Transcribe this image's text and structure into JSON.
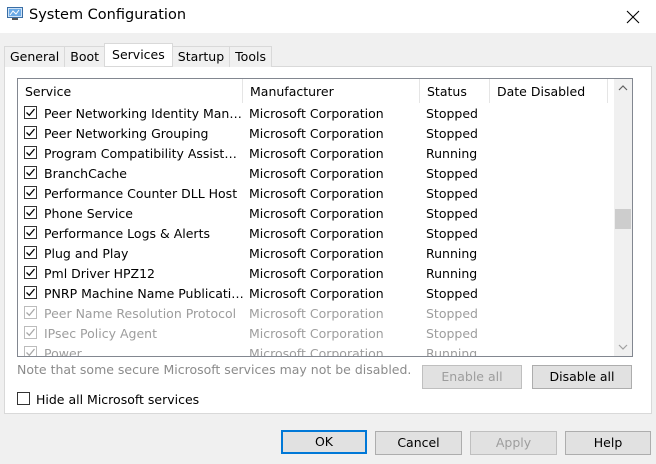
{
  "window": {
    "title": "System Configuration"
  },
  "tabs": [
    {
      "label": "General"
    },
    {
      "label": "Boot"
    },
    {
      "label": "Services",
      "active": true
    },
    {
      "label": "Startup"
    },
    {
      "label": "Tools"
    }
  ],
  "table": {
    "columns": [
      "Service",
      "Manufacturer",
      "Status",
      "Date Disabled"
    ],
    "rows": [
      {
        "service": "Peer Networking Identity Manager",
        "manufacturer": "Microsoft Corporation",
        "status": "Stopped",
        "date_disabled": "",
        "checked": true,
        "disabled": false
      },
      {
        "service": "Peer Networking Grouping",
        "manufacturer": "Microsoft Corporation",
        "status": "Stopped",
        "date_disabled": "",
        "checked": true,
        "disabled": false
      },
      {
        "service": "Program Compatibility Assistant ...",
        "manufacturer": "Microsoft Corporation",
        "status": "Running",
        "date_disabled": "",
        "checked": true,
        "disabled": false
      },
      {
        "service": "BranchCache",
        "manufacturer": "Microsoft Corporation",
        "status": "Stopped",
        "date_disabled": "",
        "checked": true,
        "disabled": false
      },
      {
        "service": "Performance Counter DLL Host",
        "manufacturer": "Microsoft Corporation",
        "status": "Stopped",
        "date_disabled": "",
        "checked": true,
        "disabled": false
      },
      {
        "service": "Phone Service",
        "manufacturer": "Microsoft Corporation",
        "status": "Stopped",
        "date_disabled": "",
        "checked": true,
        "disabled": false
      },
      {
        "service": "Performance Logs & Alerts",
        "manufacturer": "Microsoft Corporation",
        "status": "Stopped",
        "date_disabled": "",
        "checked": true,
        "disabled": false
      },
      {
        "service": "Plug and Play",
        "manufacturer": "Microsoft Corporation",
        "status": "Running",
        "date_disabled": "",
        "checked": true,
        "disabled": false
      },
      {
        "service": "Pml Driver HPZ12",
        "manufacturer": "Microsoft Corporation",
        "status": "Running",
        "date_disabled": "",
        "checked": true,
        "disabled": false
      },
      {
        "service": "PNRP Machine Name Publication...",
        "manufacturer": "Microsoft Corporation",
        "status": "Stopped",
        "date_disabled": "",
        "checked": true,
        "disabled": false
      },
      {
        "service": "Peer Name Resolution Protocol",
        "manufacturer": "Microsoft Corporation",
        "status": "Stopped",
        "date_disabled": "",
        "checked": true,
        "disabled": true
      },
      {
        "service": "IPsec Policy Agent",
        "manufacturer": "Microsoft Corporation",
        "status": "Stopped",
        "date_disabled": "",
        "checked": true,
        "disabled": true
      },
      {
        "service": "Power",
        "manufacturer": "Microsoft Corporation",
        "status": "Running",
        "date_disabled": "",
        "checked": true,
        "disabled": true
      }
    ]
  },
  "note": "Note that some secure Microsoft services may not be disabled.",
  "buttons": {
    "enable_all": "Enable all",
    "disable_all": "Disable all",
    "ok": "OK",
    "cancel": "Cancel",
    "apply": "Apply",
    "help": "Help"
  },
  "hide_ms": {
    "label": "Hide all Microsoft services",
    "checked": false
  },
  "colors": {
    "accent": "#0078d7",
    "disabled_text": "#9d9d9d"
  }
}
